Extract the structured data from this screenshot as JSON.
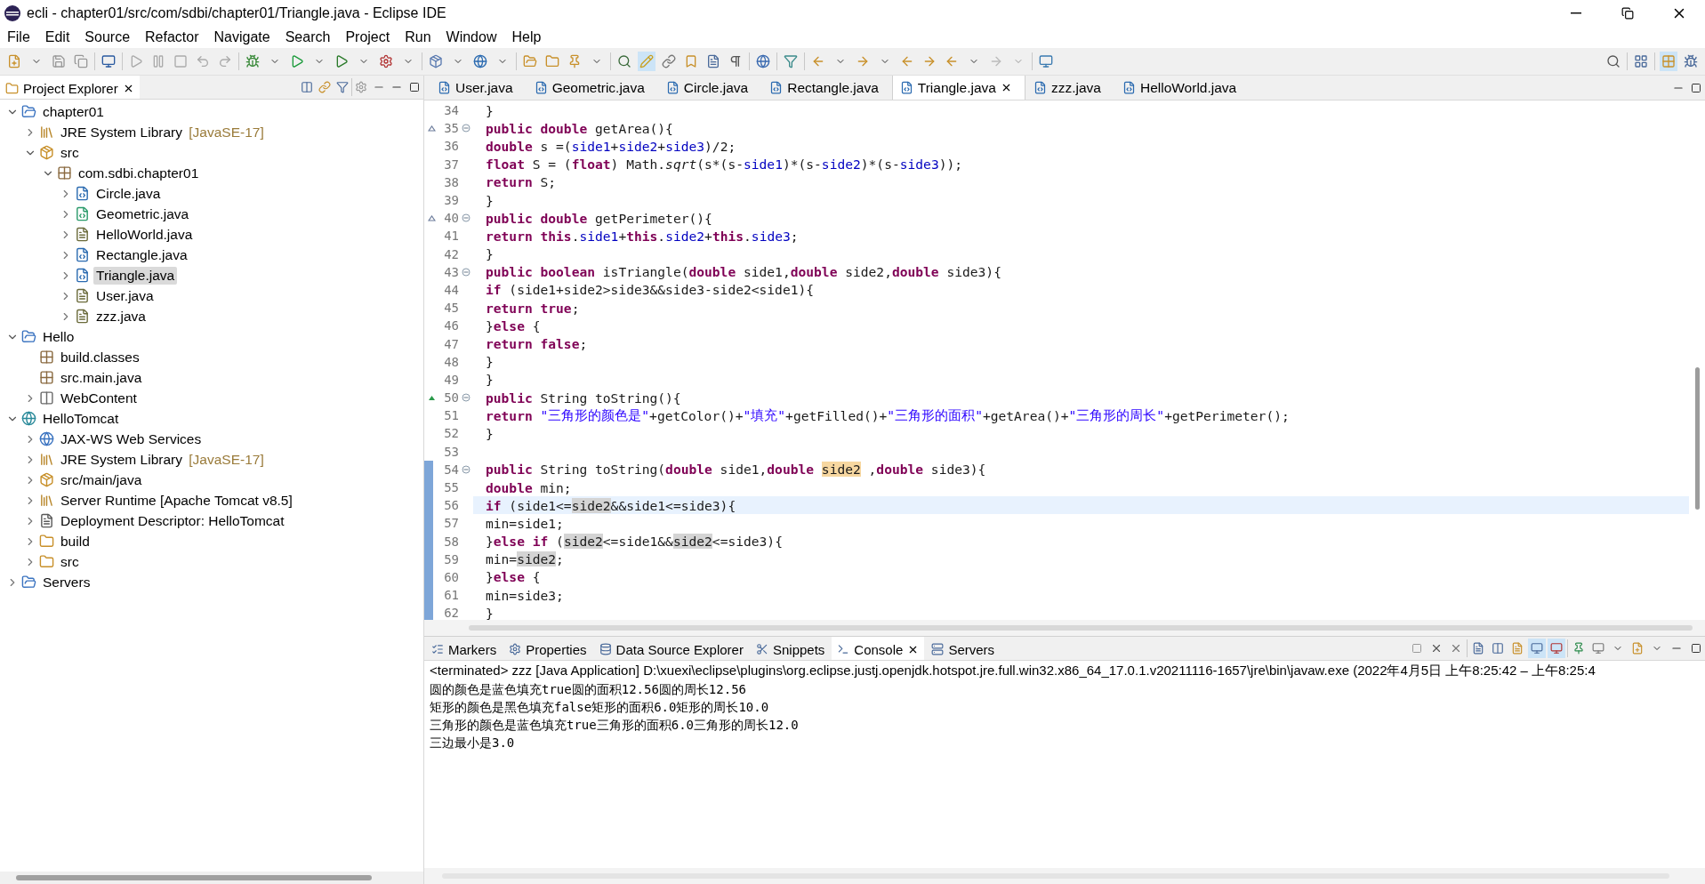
{
  "window": {
    "title": "ecli - chapter01/src/com/sdbi/chapter01/Triangle.java - Eclipse IDE"
  },
  "menu": [
    "File",
    "Edit",
    "Source",
    "Refactor",
    "Navigate",
    "Search",
    "Project",
    "Run",
    "Window",
    "Help"
  ],
  "explorer": {
    "title": "Project Explorer",
    "selected": true,
    "tree": [
      {
        "label": "chapter01",
        "kind": "project",
        "expanded": true,
        "selected": false,
        "children": [
          {
            "label": "JRE System Library",
            "note": "[JavaSE-17]",
            "kind": "library",
            "expanded": false,
            "selected": false
          },
          {
            "label": "src",
            "kind": "srcfolder",
            "expanded": true,
            "selected": false,
            "children": [
              {
                "label": "com.sdbi.chapter01",
                "kind": "package",
                "expanded": true,
                "selected": false,
                "children": [
                  {
                    "label": "Circle.java",
                    "kind": "class",
                    "expanded": false,
                    "selected": false
                  },
                  {
                    "label": "Geometric.java",
                    "kind": "abstract",
                    "expanded": false,
                    "selected": false
                  },
                  {
                    "label": "HelloWorld.java",
                    "kind": "file",
                    "expanded": false,
                    "selected": false
                  },
                  {
                    "label": "Rectangle.java",
                    "kind": "class",
                    "expanded": false,
                    "selected": false
                  },
                  {
                    "label": "Triangle.java",
                    "kind": "class",
                    "expanded": false,
                    "selected": true
                  },
                  {
                    "label": "User.java",
                    "kind": "file",
                    "expanded": false,
                    "selected": false
                  },
                  {
                    "label": "zzz.java",
                    "kind": "file",
                    "expanded": false,
                    "selected": false
                  }
                ]
              }
            ]
          }
        ]
      },
      {
        "label": "Hello",
        "kind": "project",
        "expanded": true,
        "selected": false,
        "children": [
          {
            "label": "build.classes",
            "kind": "package",
            "selected": false
          },
          {
            "label": "src.main.java",
            "kind": "package",
            "selected": false
          },
          {
            "label": "WebContent",
            "kind": "webfolder",
            "expanded": false,
            "selected": false
          }
        ]
      },
      {
        "label": "HelloTomcat",
        "kind": "webproject",
        "expanded": true,
        "selected": false,
        "children": [
          {
            "label": "JAX-WS Web Services",
            "kind": "service",
            "expanded": false,
            "selected": false
          },
          {
            "label": "JRE System Library",
            "note": "[JavaSE-17]",
            "kind": "library",
            "expanded": false,
            "selected": false
          },
          {
            "label": "src/main/java",
            "kind": "srcfolder",
            "expanded": false,
            "selected": false
          },
          {
            "label": "Server Runtime [Apache Tomcat v8.5]",
            "kind": "library",
            "expanded": false,
            "selected": false
          },
          {
            "label": "Deployment Descriptor: HelloTomcat",
            "kind": "descriptor",
            "expanded": false,
            "selected": false
          },
          {
            "label": "build",
            "kind": "folder",
            "expanded": false,
            "selected": false
          },
          {
            "label": "src",
            "kind": "folder",
            "expanded": false,
            "selected": false
          }
        ]
      },
      {
        "label": "Servers",
        "kind": "project",
        "expanded": false,
        "selected": false
      }
    ]
  },
  "editor_tabs": [
    {
      "label": "User.java",
      "selected": false
    },
    {
      "label": "Geometric.java",
      "selected": false
    },
    {
      "label": "Circle.java",
      "selected": false
    },
    {
      "label": "Rectangle.java",
      "selected": false
    },
    {
      "label": "Triangle.java",
      "selected": true
    },
    {
      "label": "zzz.java",
      "selected": false
    },
    {
      "label": "HelloWorld.java",
      "selected": false
    }
  ],
  "code": [
    {
      "number": "34",
      "tokens": [
        {
          "kind": "plain",
          "text": "}"
        }
      ]
    },
    {
      "number": "35",
      "override": true,
      "fold": true,
      "tokens": [
        {
          "kind": "kw",
          "text": "public "
        },
        {
          "kind": "kw",
          "text": "double"
        },
        {
          "kind": "plain",
          "text": " getArea(){"
        }
      ]
    },
    {
      "number": "36",
      "tokens": [
        {
          "kind": "kw",
          "text": "double"
        },
        {
          "kind": "plain",
          "text": " s =("
        },
        {
          "kind": "field",
          "text": "side1"
        },
        {
          "kind": "plain",
          "text": "+"
        },
        {
          "kind": "field",
          "text": "side2"
        },
        {
          "kind": "plain",
          "text": "+"
        },
        {
          "kind": "field",
          "text": "side3"
        },
        {
          "kind": "plain",
          "text": ")/2;"
        }
      ]
    },
    {
      "number": "37",
      "tokens": [
        {
          "kind": "kw",
          "text": "float"
        },
        {
          "kind": "plain",
          "text": " S = ("
        },
        {
          "kind": "kw",
          "text": "float"
        },
        {
          "kind": "plain",
          "text": ") Math."
        },
        {
          "kind": "italic",
          "text": "sqrt"
        },
        {
          "kind": "plain",
          "text": "(s*(s-"
        },
        {
          "kind": "field",
          "text": "side1"
        },
        {
          "kind": "plain",
          "text": ")*(s-"
        },
        {
          "kind": "field",
          "text": "side2"
        },
        {
          "kind": "plain",
          "text": ")*(s-"
        },
        {
          "kind": "field",
          "text": "side3"
        },
        {
          "kind": "plain",
          "text": "));"
        }
      ]
    },
    {
      "number": "38",
      "tokens": [
        {
          "kind": "kw",
          "text": "return"
        },
        {
          "kind": "plain",
          "text": " S;"
        }
      ]
    },
    {
      "number": "39",
      "tokens": [
        {
          "kind": "plain",
          "text": "}"
        }
      ]
    },
    {
      "number": "40",
      "override": true,
      "fold": true,
      "tokens": [
        {
          "kind": "kw",
          "text": "public "
        },
        {
          "kind": "kw",
          "text": "double"
        },
        {
          "kind": "plain",
          "text": " getPerimeter(){"
        }
      ]
    },
    {
      "number": "41",
      "tokens": [
        {
          "kind": "kw",
          "text": "return "
        },
        {
          "kind": "kw",
          "text": "this"
        },
        {
          "kind": "plain",
          "text": "."
        },
        {
          "kind": "field",
          "text": "side1"
        },
        {
          "kind": "plain",
          "text": "+"
        },
        {
          "kind": "kw",
          "text": "this"
        },
        {
          "kind": "plain",
          "text": "."
        },
        {
          "kind": "field",
          "text": "side2"
        },
        {
          "kind": "plain",
          "text": "+"
        },
        {
          "kind": "kw",
          "text": "this"
        },
        {
          "kind": "plain",
          "text": "."
        },
        {
          "kind": "field",
          "text": "side3"
        },
        {
          "kind": "plain",
          "text": ";"
        }
      ]
    },
    {
      "number": "42",
      "tokens": [
        {
          "kind": "plain",
          "text": "}"
        }
      ]
    },
    {
      "number": "43",
      "fold": true,
      "tokens": [
        {
          "kind": "kw",
          "text": "public "
        },
        {
          "kind": "kw",
          "text": "boolean"
        },
        {
          "kind": "plain",
          "text": " isTriangle("
        },
        {
          "kind": "kw",
          "text": "double"
        },
        {
          "kind": "plain",
          "text": " side1,"
        },
        {
          "kind": "kw",
          "text": "double"
        },
        {
          "kind": "plain",
          "text": " side2,"
        },
        {
          "kind": "kw",
          "text": "double"
        },
        {
          "kind": "plain",
          "text": " side3){"
        }
      ]
    },
    {
      "number": "44",
      "tokens": [
        {
          "kind": "kw",
          "text": "if"
        },
        {
          "kind": "plain",
          "text": " (side1+side2>side3&&side3-side2<side1){"
        }
      ]
    },
    {
      "number": "45",
      "tokens": [
        {
          "kind": "kw",
          "text": "return "
        },
        {
          "kind": "kw",
          "text": "true"
        },
        {
          "kind": "plain",
          "text": ";"
        }
      ]
    },
    {
      "number": "46",
      "tokens": [
        {
          "kind": "plain",
          "text": "}"
        },
        {
          "kind": "kw",
          "text": "else"
        },
        {
          "kind": "plain",
          "text": " {"
        }
      ]
    },
    {
      "number": "47",
      "tokens": [
        {
          "kind": "kw",
          "text": "return "
        },
        {
          "kind": "kw",
          "text": "false"
        },
        {
          "kind": "plain",
          "text": ";"
        }
      ]
    },
    {
      "number": "48",
      "tokens": [
        {
          "kind": "plain",
          "text": "}"
        }
      ]
    },
    {
      "number": "49",
      "tokens": [
        {
          "kind": "plain",
          "text": "}"
        }
      ]
    },
    {
      "number": "50",
      "implements": true,
      "fold": true,
      "tokens": [
        {
          "kind": "kw",
          "text": "public"
        },
        {
          "kind": "plain",
          "text": " String toString(){"
        }
      ]
    },
    {
      "number": "51",
      "tokens": [
        {
          "kind": "kw",
          "text": "return "
        },
        {
          "kind": "str",
          "text": "\"三角形的颜色是\""
        },
        {
          "kind": "plain",
          "text": "+getColor()+"
        },
        {
          "kind": "str",
          "text": "\"填充\""
        },
        {
          "kind": "plain",
          "text": "+getFilled()+"
        },
        {
          "kind": "str",
          "text": "\"三角形的面积\""
        },
        {
          "kind": "plain",
          "text": "+getArea()+"
        },
        {
          "kind": "str",
          "text": "\"三角形的周长\""
        },
        {
          "kind": "plain",
          "text": "+getPerimeter();"
        }
      ]
    },
    {
      "number": "52",
      "tokens": [
        {
          "kind": "plain",
          "text": "}"
        }
      ]
    },
    {
      "number": "53"
    },
    {
      "number": "54",
      "fold": true,
      "changed": true,
      "tokens": [
        {
          "kind": "kw",
          "text": "public"
        },
        {
          "kind": "plain",
          "text": " String toString("
        },
        {
          "kind": "kw",
          "text": "double"
        },
        {
          "kind": "plain",
          "text": " side1,"
        },
        {
          "kind": "kw",
          "text": "double "
        },
        {
          "kind": "decl",
          "text": "side2"
        },
        {
          "kind": "plain",
          "text": " ,"
        },
        {
          "kind": "kw",
          "text": "double"
        },
        {
          "kind": "plain",
          "text": " side3){"
        }
      ]
    },
    {
      "number": "55",
      "changed": true,
      "tokens": [
        {
          "kind": "kw",
          "text": "double"
        },
        {
          "kind": "plain",
          "text": " min;"
        }
      ]
    },
    {
      "number": "56",
      "changed": true,
      "current": true,
      "tokens": [
        {
          "kind": "kw",
          "text": "if"
        },
        {
          "kind": "plain",
          "text": " (side1<="
        },
        {
          "kind": "occ",
          "text": "side2"
        },
        {
          "kind": "plain",
          "text": "&&side1<=side3){"
        }
      ]
    },
    {
      "number": "57",
      "changed": true,
      "tokens": [
        {
          "kind": "plain",
          "text": "min=side1;"
        }
      ]
    },
    {
      "number": "58",
      "changed": true,
      "tokens": [
        {
          "kind": "plain",
          "text": "}"
        },
        {
          "kind": "kw",
          "text": "else "
        },
        {
          "kind": "kw",
          "text": "if"
        },
        {
          "kind": "plain",
          "text": " ("
        },
        {
          "kind": "occ",
          "text": "side2"
        },
        {
          "kind": "plain",
          "text": "<=side1&&"
        },
        {
          "kind": "occ",
          "text": "side2"
        },
        {
          "kind": "plain",
          "text": "<=side3){"
        }
      ]
    },
    {
      "number": "59",
      "changed": true,
      "tokens": [
        {
          "kind": "plain",
          "text": "min="
        },
        {
          "kind": "occ",
          "text": "side2"
        },
        {
          "kind": "plain",
          "text": ";"
        }
      ]
    },
    {
      "number": "60",
      "changed": true,
      "tokens": [
        {
          "kind": "plain",
          "text": "}"
        },
        {
          "kind": "kw",
          "text": "else"
        },
        {
          "kind": "plain",
          "text": " {"
        }
      ]
    },
    {
      "number": "61",
      "changed": true,
      "tokens": [
        {
          "kind": "plain",
          "text": "min=side3;"
        }
      ]
    },
    {
      "number": "62",
      "changed": true,
      "tokens": [
        {
          "kind": "plain",
          "text": "}"
        }
      ]
    }
  ],
  "bottom_tabs": [
    {
      "label": "Markers",
      "selected": false
    },
    {
      "label": "Properties",
      "selected": false
    },
    {
      "label": "Data Source Explorer",
      "selected": false
    },
    {
      "label": "Snippets",
      "selected": false
    },
    {
      "label": "Console",
      "selected": true
    },
    {
      "label": "Servers",
      "selected": false
    }
  ],
  "console": {
    "header": "<terminated> zzz [Java Application] D:\\xuexi\\eclipse\\plugins\\org.eclipse.justj.openjdk.hotspot.jre.full.win32.x86_64_17.0.1.v20211116-1657\\jre\\bin\\javaw.exe  (2022年4月5日 上午8:25:42 – 上午8:25:4",
    "lines": [
      "圆的颜色是蓝色填充true圆的面积12.56圆的周长12.56",
      "矩形的颜色是黑色填充false矩形的面积6.0矩形的周长10.0",
      "三角形的颜色是蓝色填充true三角形的面积6.0三角形的周长12.0",
      "三边最小是3.0"
    ]
  }
}
